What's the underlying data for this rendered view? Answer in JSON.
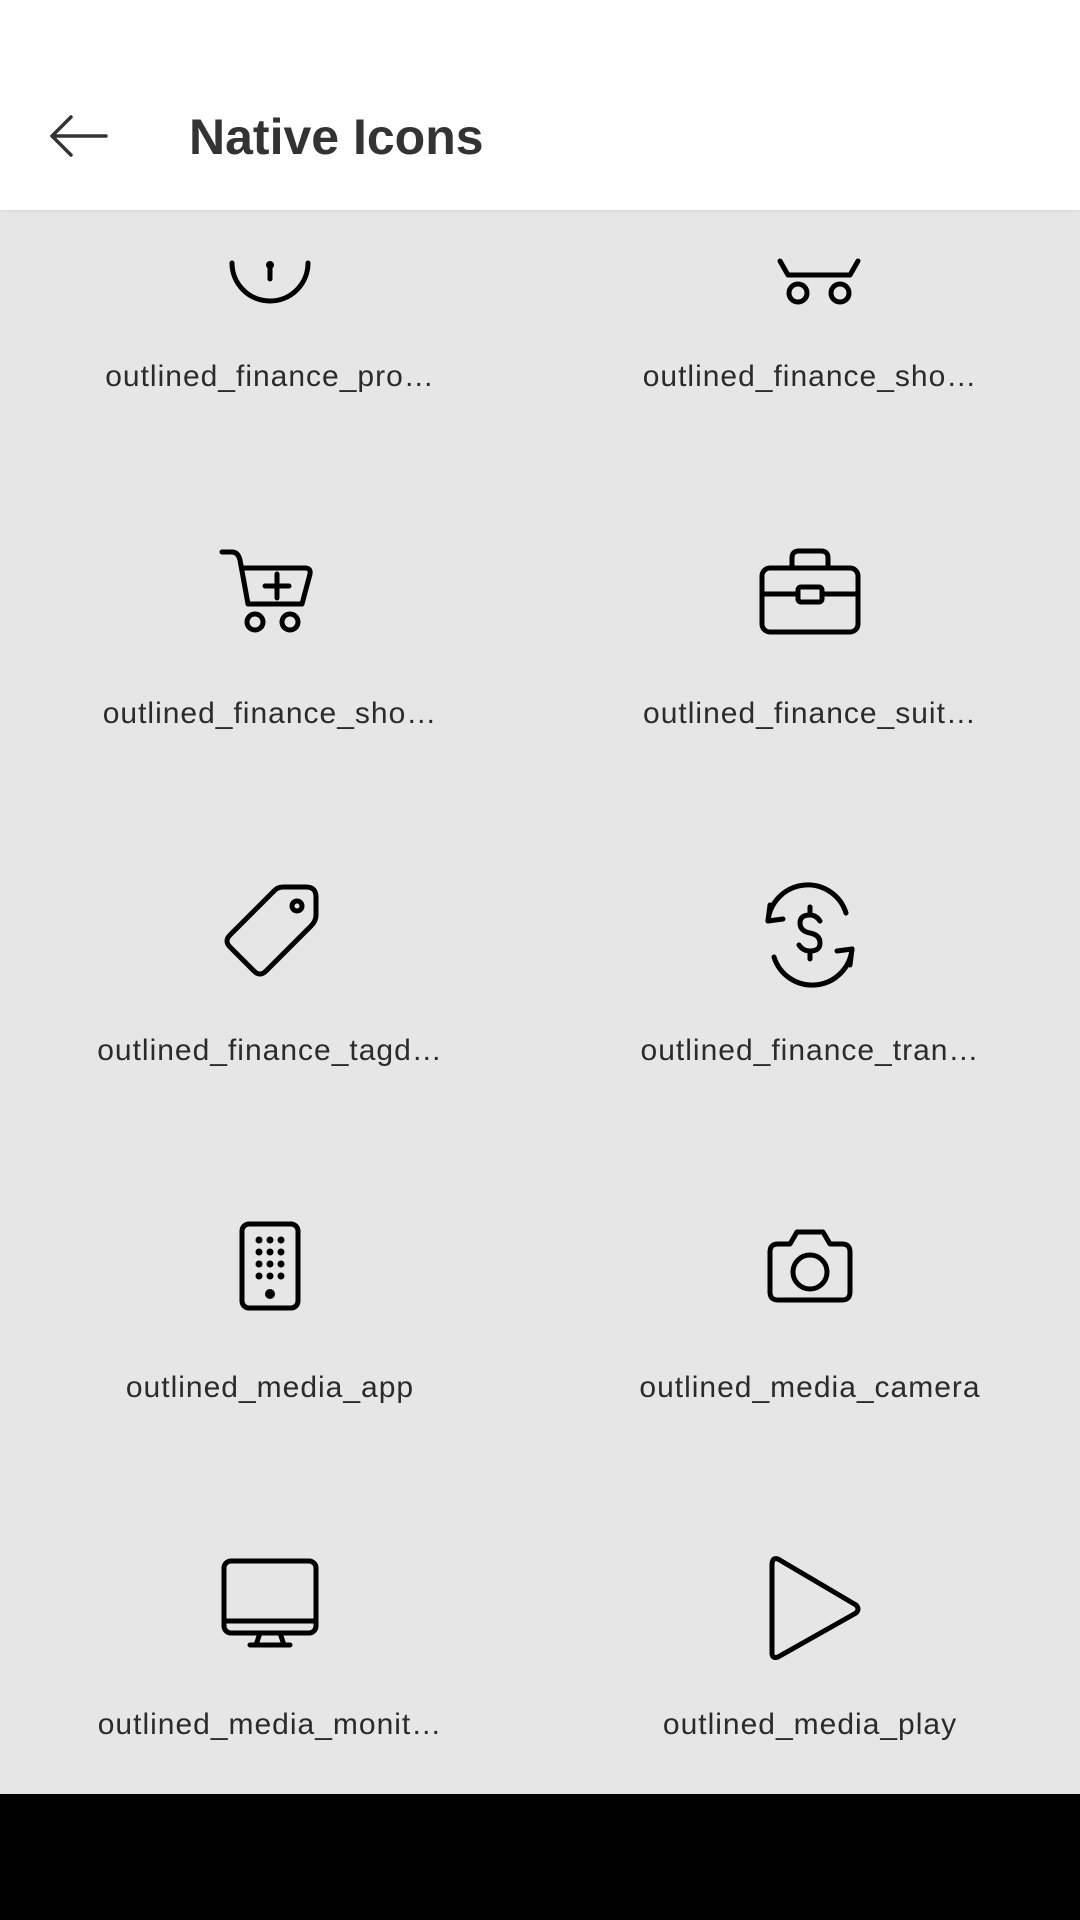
{
  "header": {
    "title": "Native Icons",
    "back_icon": "arrow-left-icon"
  },
  "icons": [
    {
      "label": "outlined_finance_pro…",
      "icon": "finance-pro-icon"
    },
    {
      "label": "outlined_finance_sho…",
      "icon": "finance-shopping-cart-icon"
    },
    {
      "label": "outlined_finance_sho…",
      "icon": "shopping-cart-add-icon"
    },
    {
      "label": "outlined_finance_suit…",
      "icon": "briefcase-icon"
    },
    {
      "label": "outlined_finance_tagd…",
      "icon": "price-tag-icon"
    },
    {
      "label": "outlined_finance_tran…",
      "icon": "currency-exchange-icon"
    },
    {
      "label": "outlined_media_app",
      "icon": "remote-app-icon"
    },
    {
      "label": "outlined_media_camera",
      "icon": "camera-icon"
    },
    {
      "label": "outlined_media_monit…",
      "icon": "monitor-icon"
    },
    {
      "label": "outlined_media_play",
      "icon": "play-icon"
    }
  ]
}
